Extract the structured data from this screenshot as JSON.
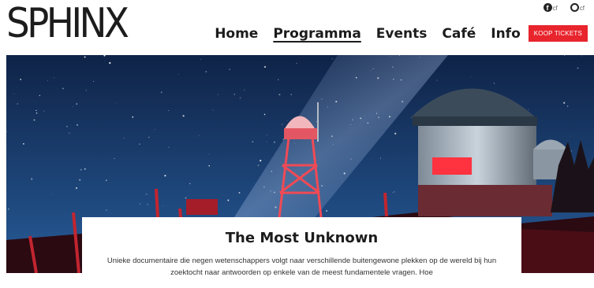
{
  "brand": {
    "logo_text": "SPHINX"
  },
  "social": {
    "items": [
      {
        "icon": "facebook-icon",
        "glyph": "f",
        "suffix": "cf"
      },
      {
        "icon": "instagram-icon",
        "suffix": "cf"
      }
    ]
  },
  "nav": {
    "items": [
      "Home",
      "Programma",
      "Events",
      "Café",
      "Info"
    ],
    "active": "Programma",
    "ticket_label": "KOOP TICKETS"
  },
  "hero": {
    "title": "The Most Unknown",
    "description": "Unieke documentaire die negen wetenschappers volgt naar verschillende buitengewone plekken op de wereld bij hun zoektocht naar antwoorden op enkele van de meest fundamentele vragen. Hoe"
  },
  "colors": {
    "accent": "#e8242c",
    "text": "#1c1c1c",
    "sky_top": "#10254a",
    "sky_bottom": "#2a5c99",
    "ground": "#3a0a10",
    "glow": "#d0202a"
  }
}
